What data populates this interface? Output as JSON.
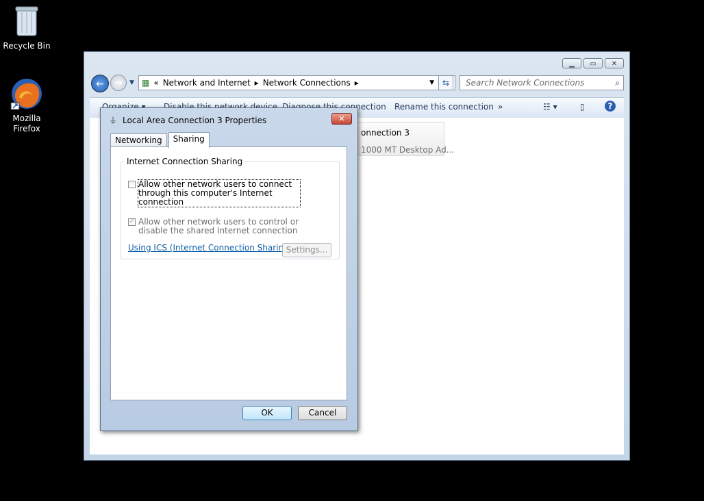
{
  "desktop": {
    "icons": [
      {
        "label": "Recycle Bin",
        "icon": "recycle-bin-icon"
      },
      {
        "label": "Mozilla Firefox",
        "icon": "firefox-icon"
      }
    ]
  },
  "explorer": {
    "address": {
      "prefix": "«",
      "crumbs": [
        "Network and Internet",
        "Network Connections"
      ],
      "separator": "▸"
    },
    "search_placeholder": "Search Network Connections",
    "toolbar": {
      "organize": "Organize ▾",
      "disable": "Disable this network device",
      "diagnose": "Diagnose this connection",
      "rename": "Rename this connection",
      "more": "»"
    },
    "tile": {
      "name": "onnection 3",
      "device": "1000 MT Desktop Ad..."
    }
  },
  "dialog": {
    "title": "Local Area Connection 3 Properties",
    "tabs": [
      "Networking",
      "Sharing"
    ],
    "active_tab": "Sharing",
    "group_label": "Internet Connection Sharing",
    "option1": {
      "text": "Allow other network users to connect through this computer's Internet connection",
      "checked": false
    },
    "option2": {
      "text": "Allow other network users to control or disable the shared Internet connection",
      "checked": true,
      "disabled": true
    },
    "link": "Using ICS (Internet Connection Sharing)",
    "settings_label": "Settings...",
    "ok_label": "OK",
    "cancel_label": "Cancel"
  },
  "colors": {
    "desktop": "#000000",
    "link": "#0c5ea8",
    "close": "#c74533"
  }
}
